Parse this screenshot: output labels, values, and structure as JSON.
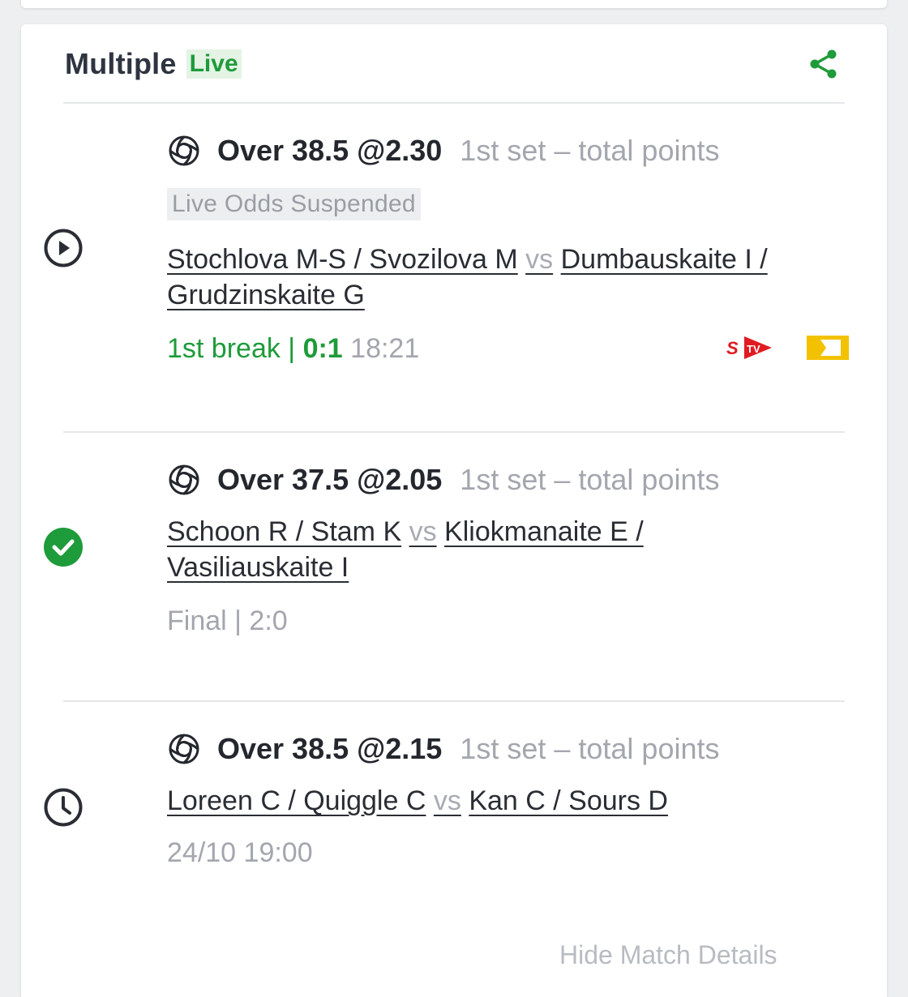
{
  "card": {
    "title": "Multiple",
    "live_badge": "Live"
  },
  "selections": [
    {
      "status": "live",
      "pick": "Over 38.5 @2.30",
      "market": "1st set  –  total points",
      "suspended_label": "Live Odds Suspended",
      "team_a": "Stochlova M-S / Svozilova M",
      "vs": "vs",
      "team_b_line1": "Dumbauskaite I /",
      "team_b_line2": "Grudzinskaite G",
      "period": "1st break | ",
      "score": "0:1",
      "time": "18:21",
      "stv_label": "STV"
    },
    {
      "status": "won",
      "pick": "Over 37.5 @2.05",
      "market": "1st set  –  total points",
      "team_a": "Schoon R / Stam K",
      "vs": "vs",
      "team_b_line1": "Kliokmanaite E /",
      "team_b_line2": "Vasiliauskaite I",
      "result": "Final | 2:0"
    },
    {
      "status": "pending",
      "pick": "Over 38.5 @2.15",
      "market": "1st set  –  total points",
      "team_a": "Loreen C / Quiggle C",
      "vs": "vs",
      "team_b": "Kan C / Sours D",
      "start": "24/10 19:00"
    }
  ],
  "footer": {
    "link": "Hide Match Details"
  },
  "colors": {
    "accent_green": "#1e9b3a",
    "live_badge_bg": "#e4f3e4",
    "stv_red": "#e11b22",
    "tracker_yellow": "#f2c200"
  }
}
